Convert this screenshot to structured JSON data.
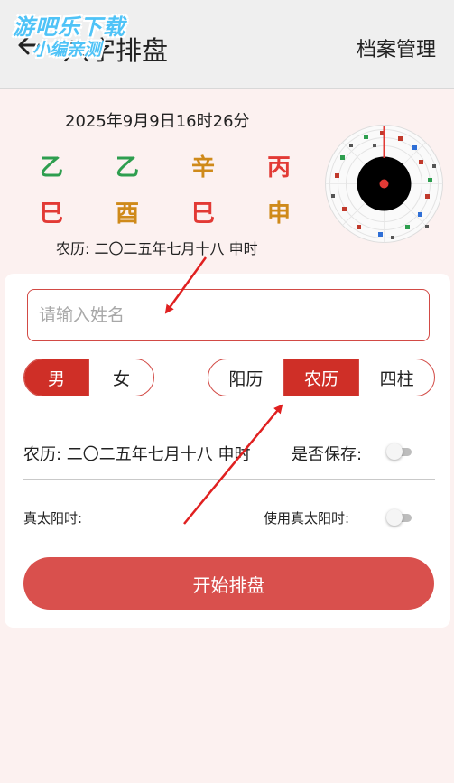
{
  "header": {
    "title": "八字排盘",
    "archive_label": "档案管理",
    "watermark_line1": "游吧乐下载",
    "watermark_line2": "小编亲测"
  },
  "chart": {
    "datetime": "2025年9月9日16时26分",
    "heavenly_stems": [
      {
        "char": "乙",
        "color": "#2e9e4f"
      },
      {
        "char": "乙",
        "color": "#2e9e4f"
      },
      {
        "char": "辛",
        "color": "#cf8a1a"
      },
      {
        "char": "丙",
        "color": "#e23a35"
      }
    ],
    "earthly_branches": [
      {
        "char": "巳",
        "color": "#e23a35"
      },
      {
        "char": "酉",
        "color": "#cf8a1a"
      },
      {
        "char": "巳",
        "color": "#e23a35"
      },
      {
        "char": "申",
        "color": "#cf8a1a"
      }
    ],
    "lunar_text": "农历: 二〇二五年七月十八 申时"
  },
  "form": {
    "name_placeholder": "请输入姓名",
    "gender": {
      "options": [
        "男",
        "女"
      ],
      "selected": "男"
    },
    "calendar": {
      "options": [
        "阳历",
        "农历",
        "四柱"
      ],
      "selected": "农历"
    },
    "lunar_summary": "农历: 二〇二五年七月十八 申时",
    "save_label": "是否保存:",
    "save_enabled": false,
    "true_solar_label": "真太阳时:",
    "use_true_solar_label": "使用真太阳时:",
    "use_true_solar_enabled": false,
    "start_button": "开始排盘"
  },
  "colors": {
    "accent": "#cf2f27",
    "button": "#d9504d",
    "wood": "#2e9e4f",
    "earth": "#cf8a1a",
    "fire": "#e23a35",
    "watermark": "#4fc3f7"
  }
}
